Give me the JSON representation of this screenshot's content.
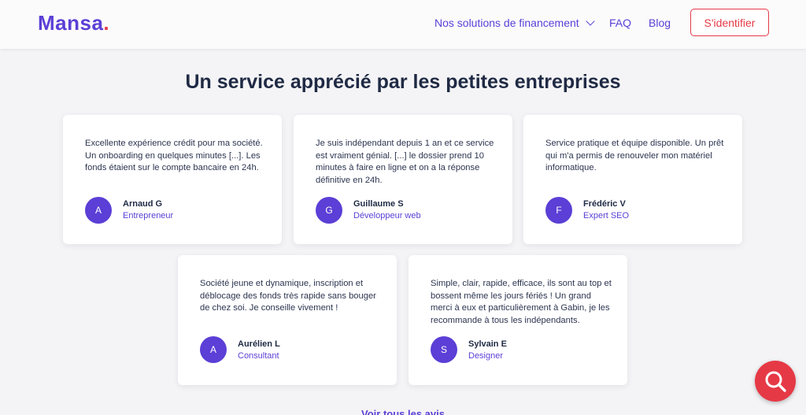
{
  "header": {
    "logo_text": "Mansa",
    "logo_dot": ".",
    "nav": {
      "solutions": "Nos solutions de financement",
      "faq": "FAQ",
      "blog": "Blog"
    },
    "login_label": "S'identifier"
  },
  "section": {
    "title": "Un service apprécié par les petites entreprises",
    "see_all": "Voir tous les avis"
  },
  "testimonials": [
    {
      "text": "Excellente expérience crédit pour ma société. Un onboarding en quelques minutes [...]. Les fonds étaient sur le compte bancaire en 24h.",
      "initial": "A",
      "name": "Arnaud G",
      "role": "Entrepreneur"
    },
    {
      "text": "Je suis indépendant depuis 1 an et ce service est vraiment génial. [...] le dossier prend 10 minutes à faire en ligne et on a la réponse définitive en 24h.",
      "initial": "G",
      "name": "Guillaume S",
      "role": "Développeur web"
    },
    {
      "text": "Service pratique et équipe disponible. Un prêt qui m'a permis de renouveler mon matériel informatique.",
      "initial": "F",
      "name": "Frédéric V",
      "role": "Expert SEO"
    },
    {
      "text": "Société jeune et dynamique, inscription et déblocage des fonds très rapide sans bouger de chez soi. Je conseille vivement !",
      "initial": "A",
      "name": "Aurélien L",
      "role": "Consultant"
    },
    {
      "text": "Simple, clair, rapide, efficace, ils sont au top et bossent même les jours fériés ! Un grand merci à eux et particulièrement à Gabin, je les recommande à tous les indépendants.",
      "initial": "S",
      "name": "Sylvain E",
      "role": "Designer"
    }
  ],
  "colors": {
    "brand": "#5b3fd6",
    "accent": "#e63946",
    "heading": "#1f2a44",
    "background": "#f4f4f6"
  },
  "icons": {
    "nav_dropdown": "chevron-down-icon",
    "search_fab": "search-icon"
  }
}
